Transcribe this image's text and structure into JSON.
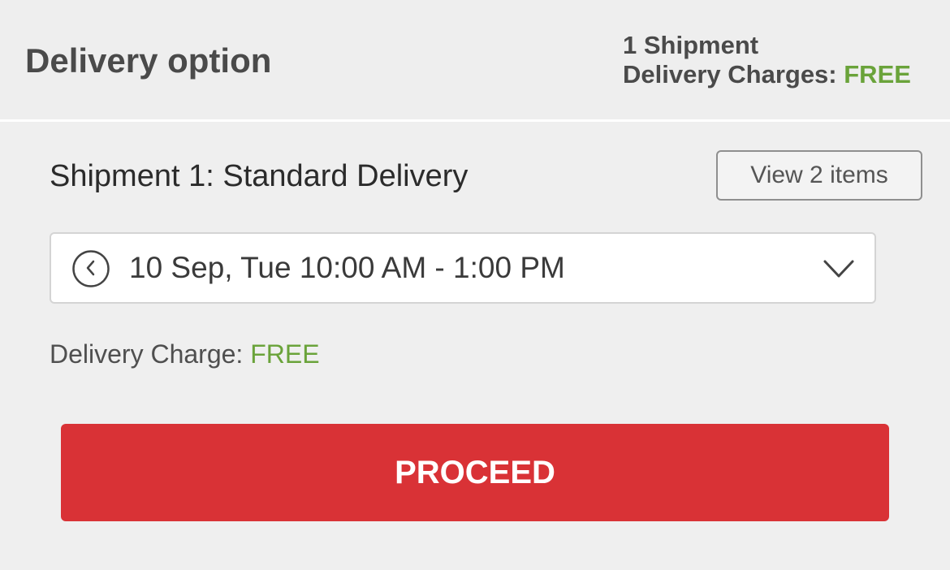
{
  "header": {
    "title": "Delivery option",
    "shipment_count": "1 Shipment",
    "charges_label": "Delivery Charges:",
    "charges_value": "FREE"
  },
  "shipment": {
    "title": "Shipment 1: Standard Delivery",
    "view_items_label": "View 2 items",
    "slot_value": "10 Sep, Tue 10:00 AM - 1:00 PM",
    "charge_label": "Delivery Charge:",
    "charge_value": "FREE"
  },
  "actions": {
    "proceed_label": "PROCEED"
  },
  "icons": {
    "slot": "clock-icon",
    "dropdown": "chevron-down-icon"
  },
  "colors": {
    "free": "#6aa33a",
    "primary": "#d93236"
  }
}
